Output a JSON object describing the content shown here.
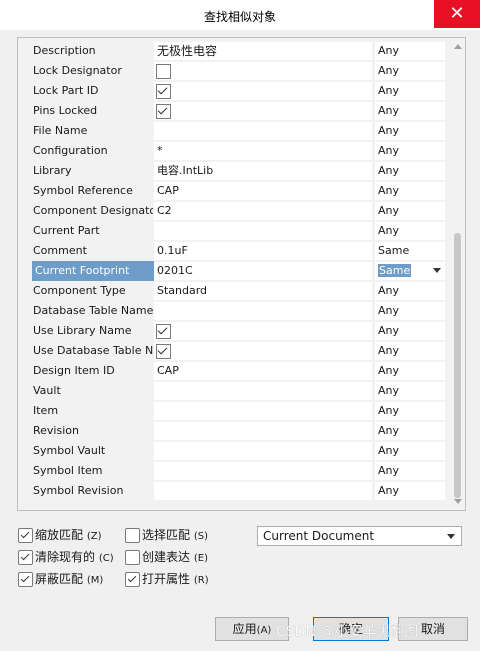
{
  "window": {
    "title": "查找相似对象",
    "close_glyph": "✕"
  },
  "grid": {
    "rows": [
      {
        "label": "Description",
        "kind": "text",
        "value": "无极性电容",
        "large": true,
        "match": "Any"
      },
      {
        "label": "Lock Designator",
        "kind": "check",
        "checked": false,
        "match": "Any"
      },
      {
        "label": "Lock Part ID",
        "kind": "check",
        "checked": true,
        "match": "Any"
      },
      {
        "label": "Pins Locked",
        "kind": "check",
        "checked": true,
        "match": "Any"
      },
      {
        "label": "File Name",
        "kind": "text",
        "value": "",
        "match": "Any"
      },
      {
        "label": "Configuration",
        "kind": "text",
        "value": "*",
        "match": "Any"
      },
      {
        "label": "Library",
        "kind": "text",
        "value": "电容.IntLib",
        "match": "Any"
      },
      {
        "label": "Symbol Reference",
        "kind": "text",
        "value": "CAP",
        "match": "Any"
      },
      {
        "label": "Component Designato",
        "kind": "text",
        "value": "C2",
        "match": "Any"
      },
      {
        "label": "Current Part",
        "kind": "text",
        "value": "",
        "match": "Any"
      },
      {
        "label": "Comment",
        "kind": "text",
        "value": "0.1uF",
        "match": "Same"
      },
      {
        "label": "Current Footprint",
        "kind": "text",
        "value": "0201C",
        "match": "Same",
        "selected": true
      },
      {
        "label": "Component Type",
        "kind": "text",
        "value": "Standard",
        "match": "Any"
      },
      {
        "label": "Database Table Name",
        "kind": "text",
        "value": "",
        "match": "Any"
      },
      {
        "label": "Use Library Name",
        "kind": "check",
        "checked": true,
        "match": "Any"
      },
      {
        "label": "Use Database Table Na",
        "kind": "check",
        "checked": true,
        "match": "Any"
      },
      {
        "label": "Design Item ID",
        "kind": "text",
        "value": "CAP",
        "match": "Any"
      },
      {
        "label": "Vault",
        "kind": "text",
        "value": "",
        "match": "Any"
      },
      {
        "label": "Item",
        "kind": "text",
        "value": "",
        "match": "Any"
      },
      {
        "label": "Revision",
        "kind": "text",
        "value": "",
        "match": "Any"
      },
      {
        "label": "Symbol Vault",
        "kind": "text",
        "value": "",
        "match": "Any"
      },
      {
        "label": "Symbol Item",
        "kind": "text",
        "value": "",
        "match": "Any"
      },
      {
        "label": "Symbol Revision",
        "kind": "text",
        "value": "",
        "match": "Any"
      }
    ]
  },
  "options": {
    "zoom": {
      "label": "缩放匹配",
      "key": "(Z)",
      "checked": true
    },
    "select": {
      "label": "选择匹配",
      "key": "(S)",
      "checked": false
    },
    "clear": {
      "label": "清除现有的",
      "key": "(C)",
      "checked": true
    },
    "create": {
      "label": "创建表达",
      "key": "(E)",
      "checked": false
    },
    "mask": {
      "label": "屏蔽匹配",
      "key": "(M)",
      "checked": true
    },
    "open": {
      "label": "打开属性",
      "key": "(R)",
      "checked": true
    }
  },
  "scope": {
    "value": "Current Document"
  },
  "buttons": {
    "apply": {
      "label": "应用",
      "key": "(A)"
    },
    "ok": {
      "label": "确定"
    },
    "cancel": {
      "label": "取消"
    }
  },
  "watermark": "CSDN @小姿羊黑翻图"
}
